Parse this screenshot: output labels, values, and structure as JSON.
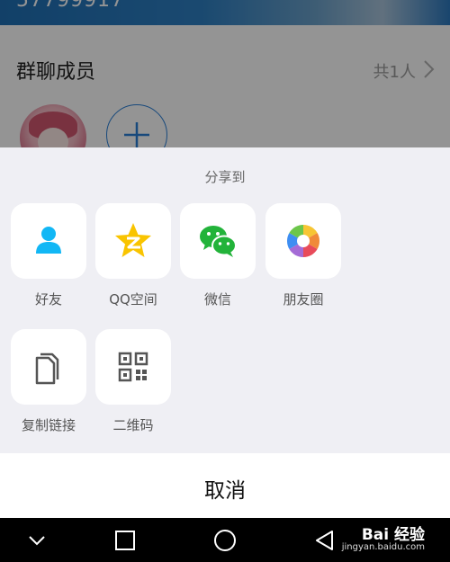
{
  "background": {
    "banner_text": "57799917",
    "members_title": "群聊成员",
    "members_count": "共1人"
  },
  "share_sheet": {
    "title": "分享到",
    "options": [
      {
        "label": "好友",
        "icon": "friend-person-icon",
        "color": "#12b7f5"
      },
      {
        "label": "QQ空间",
        "icon": "qzone-star-icon",
        "color": "#f9c400"
      },
      {
        "label": "微信",
        "icon": "wechat-icon",
        "color": "#22b33a"
      },
      {
        "label": "朋友圈",
        "icon": "moments-aperture-icon",
        "color": "#f06d3a"
      },
      {
        "label": "复制链接",
        "icon": "copy-link-icon",
        "color": "#555555"
      },
      {
        "label": "二维码",
        "icon": "qr-code-icon",
        "color": "#555555"
      }
    ],
    "cancel_label": "取消"
  },
  "nav_bar": {
    "buttons": [
      "collapse-chevron-icon",
      "recents-square-icon",
      "home-circle-icon",
      "back-triangle-icon"
    ]
  },
  "watermark": {
    "text": "Bai 经验",
    "sub": "jingyan.baidu.com"
  }
}
